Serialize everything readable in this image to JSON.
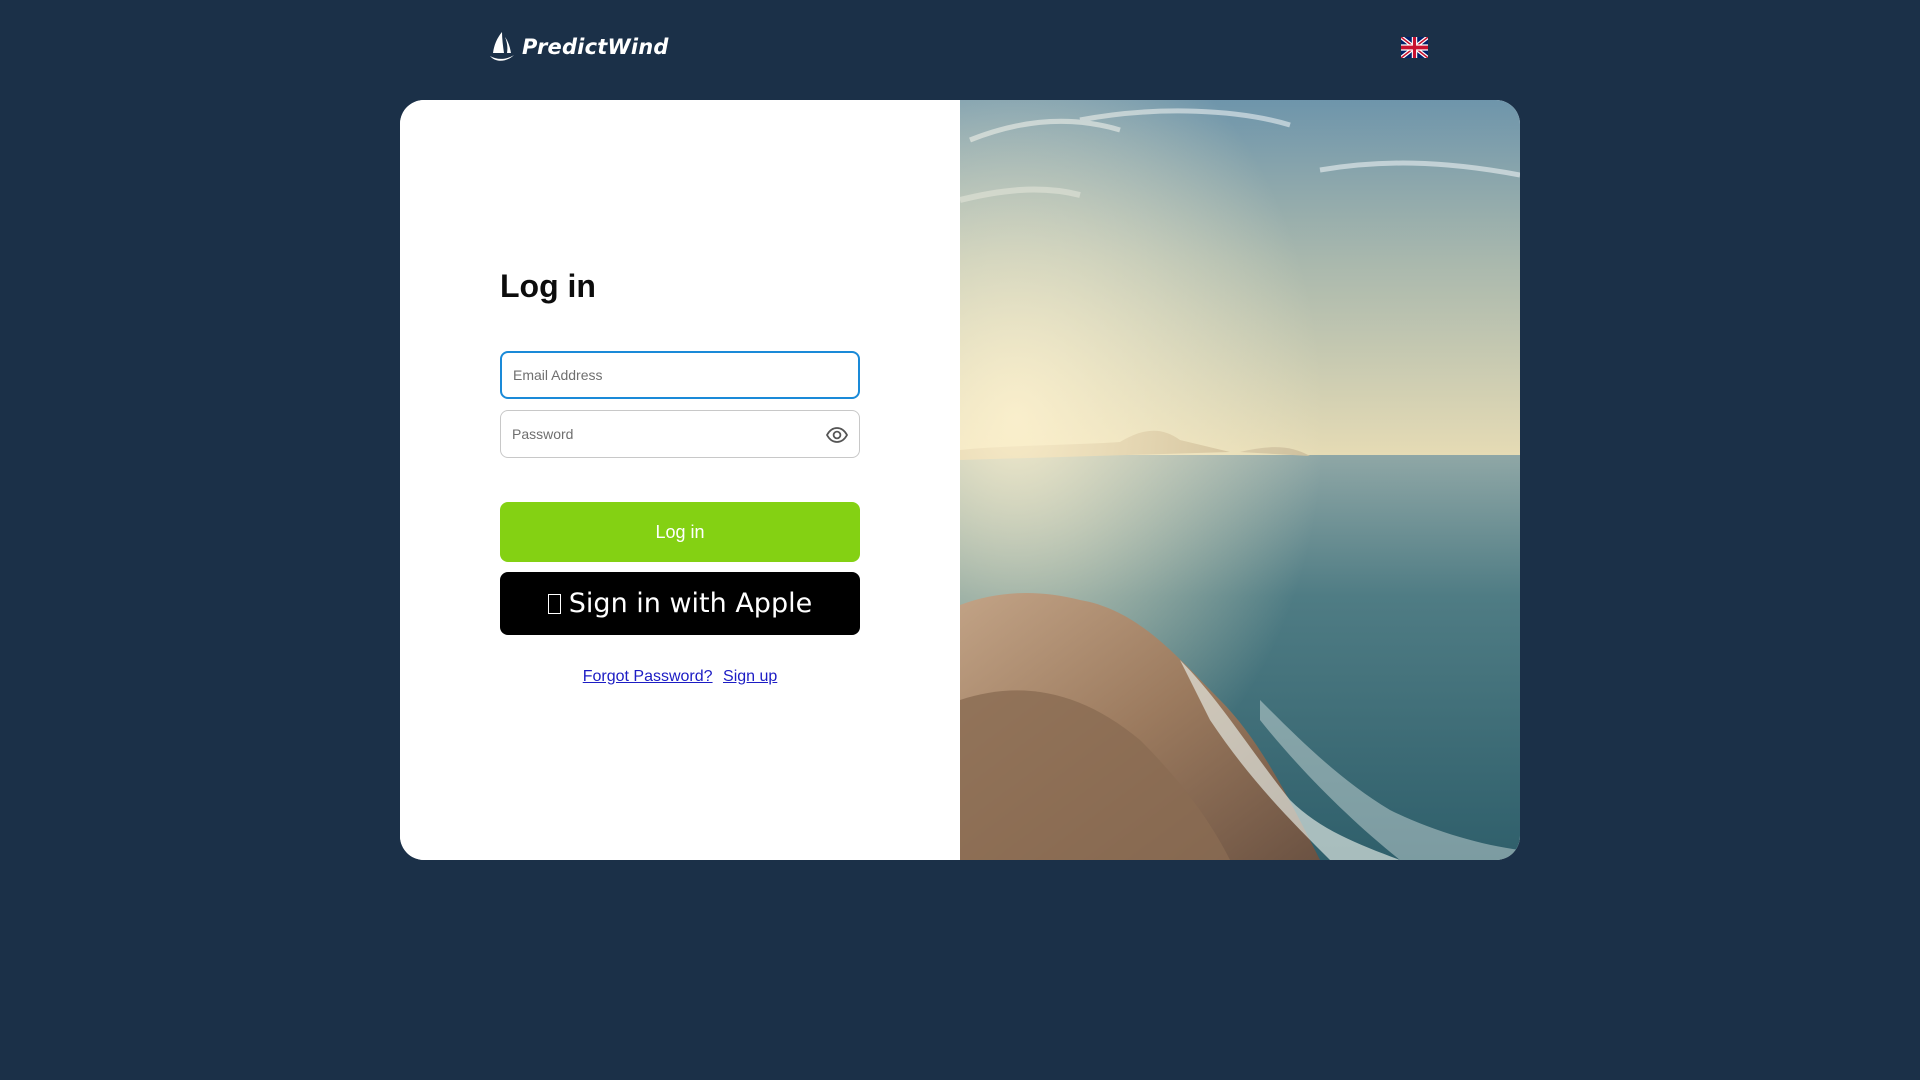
{
  "header": {
    "brand": "PredictWind",
    "language_icon": "uk-flag-icon"
  },
  "login": {
    "title": "Log in",
    "email_placeholder": "Email Address",
    "email_value": "",
    "password_placeholder": "Password",
    "password_value": "",
    "login_button": "Log in",
    "apple_button": "Sign in with Apple",
    "forgot_password": "Forgot Password?",
    "sign_up": "Sign up"
  },
  "colors": {
    "background": "#1b3048",
    "login_button": "#84d113",
    "apple_button": "#000000",
    "email_focus_border": "#1a8ad8",
    "link": "#1c1cc4"
  },
  "icons": {
    "password_toggle": "eye-icon",
    "apple_glyph": "apple-icon",
    "logo_mark": "sail-logo-icon"
  }
}
